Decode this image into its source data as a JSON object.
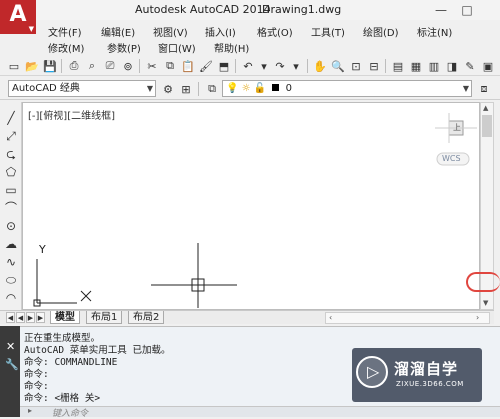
{
  "window": {
    "app_title": "Autodesk AutoCAD 2014",
    "document_title": "Drawing1.dwg",
    "logo_letter": "A",
    "minimize": "—",
    "maximize": "□"
  },
  "menu": {
    "row1": [
      "文件(F)",
      "编辑(E)",
      "视图(V)",
      "插入(I)",
      "格式(O)",
      "工具(T)",
      "绘图(D)",
      "标注(N)"
    ],
    "row2": [
      "修改(M)",
      "参数(P)",
      "窗口(W)",
      "帮助(H)"
    ]
  },
  "toolbar2": {
    "workspace": "AutoCAD 经典",
    "layer_value": "0"
  },
  "drawing": {
    "viewport_label": "[-][俯视][二维线框]",
    "viewcube_top": "上",
    "wcs_label": "WCS",
    "axis_y": "Y",
    "axis_x": "X"
  },
  "tabs": {
    "items": [
      "模型",
      "布局1",
      "布局2"
    ],
    "active": "模型"
  },
  "command": {
    "lines": [
      "正在重生成模型。",
      "AutoCAD 菜单实用工具 已加载。",
      "命令: COMMANDLINE",
      "命令:",
      "命令:",
      "命令: <栅格 关>"
    ],
    "input_placeholder": "键入命令"
  },
  "watermark": {
    "title": "溜溜自学",
    "subtitle": "ZIXUE.3D66.COM"
  },
  "colors": {
    "logo_red": "#c0282a",
    "highlight_red": "#e0463f",
    "command_bg": "#eef2f6"
  }
}
